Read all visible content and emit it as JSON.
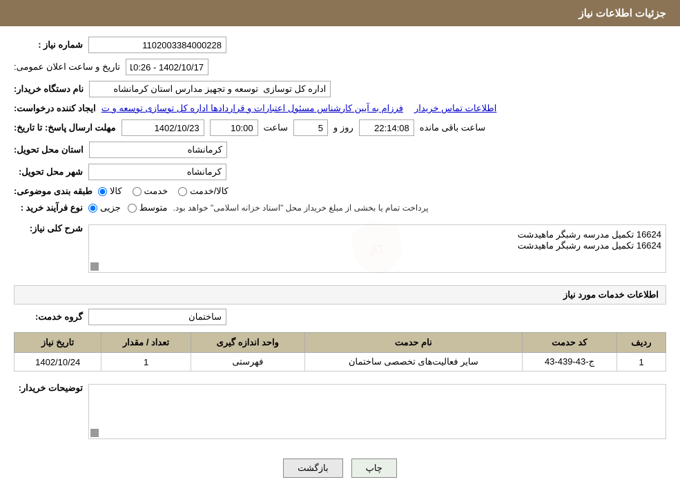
{
  "header": {
    "title": "جزئیات اطلاعات نیاز"
  },
  "fields": {
    "need_number_label": "شماره نیاز :",
    "need_number_value": "1102003384000228",
    "announce_datetime_label": "تاریخ و ساعت اعلان عمومی:",
    "announce_datetime_value": "1402/10/17 - 10:26",
    "buyer_org_label": "نام دستگاه خریدار:",
    "buyer_org_value": "اداره کل توسازی  توسعه و تجهیز مدارس استان کرمانشاه",
    "creator_label": "ایجاد کننده درخواست:",
    "creator_link": "فرزام به آیین کارشناس مسئول اعتبارات و قراردادها اداره کل توسازی  توسعه و ت",
    "creator_link2": "اطلاعات تماس خریدار",
    "deadline_label": "مهلت ارسال پاسخ: تا تاریخ:",
    "deadline_date": "1402/10/23",
    "deadline_time_label": "ساعت",
    "deadline_time": "10:00",
    "deadline_day_label": "روز و",
    "deadline_days": "5",
    "deadline_remaining_label": "ساعت باقی مانده",
    "deadline_remaining": "22:14:08",
    "province_label": "استان محل تحویل:",
    "province_value": "کرمانشاه",
    "city_label": "شهر محل تحویل:",
    "city_value": "کرمانشاه",
    "category_label": "طبقه بندی موضوعی:",
    "category_kala": "کالا",
    "category_khedmat": "خدمت",
    "category_kala_khedmat": "کالا/خدمت",
    "purchase_type_label": "نوع فرآیند خرید :",
    "purchase_jozei": "جزیی",
    "purchase_motavaset": "متوسط",
    "purchase_note": "پرداخت تمام یا بخشی از مبلغ خریداز محل \"اسناد خزانه اسلامی\" خواهد بود.",
    "need_desc_label": "شرح کلی نیاز:",
    "need_desc_value": "16624 تکمیل مدرسه رشبگر ماهیدشت",
    "services_info_title": "اطلاعات خدمات مورد نیاز",
    "service_group_label": "گروه خدمت:",
    "service_group_value": "ساختمان",
    "table": {
      "headers": [
        "ردیف",
        "کد حدمت",
        "نام حدمت",
        "واحد اندازه گیری",
        "تعداد / مقدار",
        "تاریخ نیاز"
      ],
      "rows": [
        [
          "1",
          "ج-43-439-43",
          "سایر فعالیت‌های تخصصی ساختمان",
          "فهرستی",
          "1",
          "1402/10/24"
        ]
      ]
    },
    "buyer_desc_label": "توضیحات خریدار:",
    "buyer_desc_value": "",
    "back_button": "بازگشت",
    "print_button": "چاپ"
  }
}
